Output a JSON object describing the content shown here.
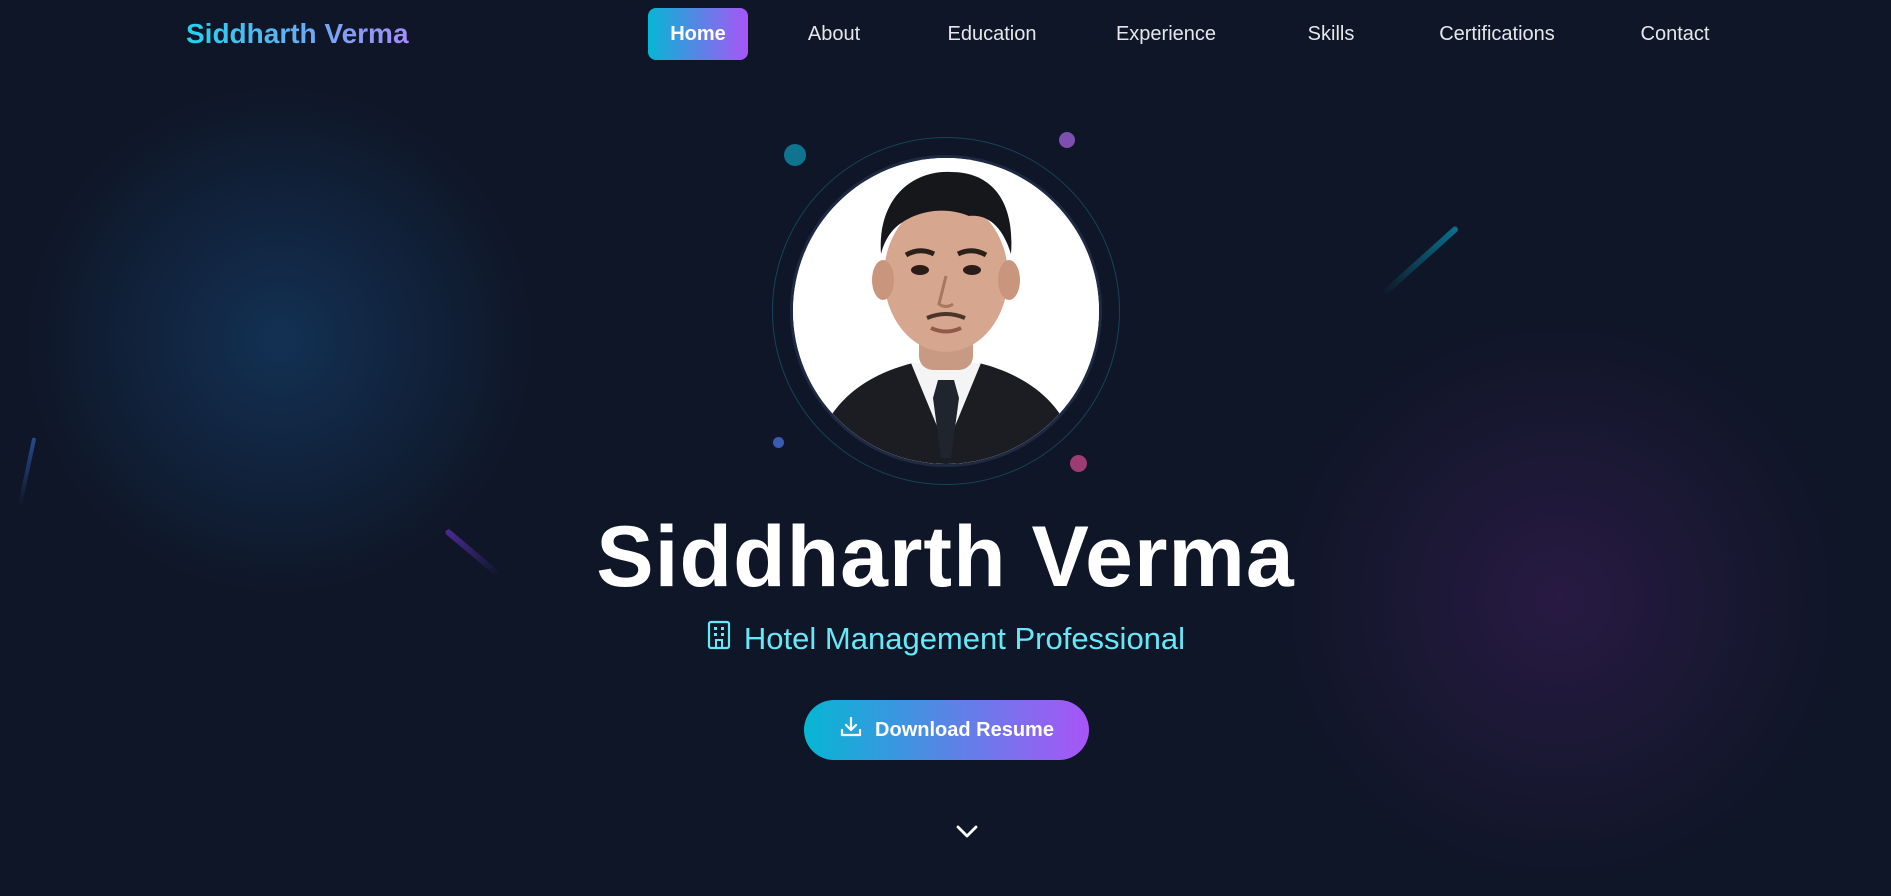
{
  "nav": {
    "brand": "Siddharth Verma",
    "items": [
      {
        "label": "Home",
        "active": true
      },
      {
        "label": "About",
        "active": false
      },
      {
        "label": "Education",
        "active": false
      },
      {
        "label": "Experience",
        "active": false
      },
      {
        "label": "Skills",
        "active": false
      },
      {
        "label": "Certifications",
        "active": false
      },
      {
        "label": "Contact",
        "active": false
      }
    ]
  },
  "hero": {
    "name": "Siddharth Verma",
    "role": "Hotel Management Professional",
    "role_icon": "building-icon",
    "cta_label": "Download Resume",
    "cta_icon": "download-icon",
    "scroll_icon": "chevron-down-icon",
    "avatar": "profile-photo"
  },
  "colors": {
    "background": "#0f1627",
    "accent_cyan": "#06b6d4",
    "accent_purple": "#a855f7",
    "role_text": "#67e8f9"
  }
}
